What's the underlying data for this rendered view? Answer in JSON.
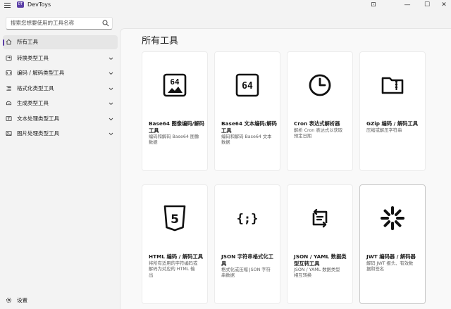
{
  "app": {
    "title": "DevToys",
    "logo_text": "DT"
  },
  "window": {
    "snap_glyph": "⊡",
    "minimize_glyph": "—",
    "maximize_glyph": "☐",
    "close_glyph": "✕"
  },
  "search": {
    "placeholder": "搜索您想要使用的工具名称"
  },
  "sidebar": {
    "items": [
      {
        "label": "所有工具",
        "icon": "home-icon",
        "selected": true
      },
      {
        "label": "转换类型工具",
        "icon": "convert-icon"
      },
      {
        "label": "编码 / 解码类型工具",
        "icon": "encode-icon"
      },
      {
        "label": "格式化类型工具",
        "icon": "format-icon"
      },
      {
        "label": "生成类型工具",
        "icon": "generate-icon"
      },
      {
        "label": "文本处理类型工具",
        "icon": "text-icon"
      },
      {
        "label": "图片处理类型工具",
        "icon": "image-icon"
      }
    ],
    "settings_label": "设置"
  },
  "main": {
    "title": "所有工具",
    "cards": [
      {
        "icon": "base64-image-icon",
        "glyph": "64",
        "title": [
          "Base64 图像编码/解码",
          "工具"
        ],
        "desc": [
          "编码和解码 Base64 图像",
          "数据"
        ]
      },
      {
        "icon": "base64-text-icon",
        "glyph": "64",
        "title": [
          "Base64 文本编码/解码",
          "工具"
        ],
        "desc": [
          "编码和解码 Base64 文本",
          "数据"
        ]
      },
      {
        "icon": "clock-icon",
        "title": [
          "Cron 表达式解析器"
        ],
        "desc": [
          "解析 Cron 表达式以获取",
          "预定日期"
        ]
      },
      {
        "icon": "gzip-icon",
        "title": [
          "GZip 编码 / 解码工具"
        ],
        "desc": [
          "压缩或解压字符串"
        ]
      },
      {
        "icon": "html5-icon",
        "glyph": "5",
        "title": [
          "HTML 编码 / 解码工具"
        ],
        "desc": [
          "将所有适用的字符编码或",
          "解码为对应的 HTML 输",
          "出"
        ]
      },
      {
        "icon": "json-icon",
        "glyph": "{;}",
        "title": [
          "JSON 字符串格式化工",
          "具"
        ],
        "desc": [
          "格式化或压缩 JSON 字符",
          "串数据"
        ]
      },
      {
        "icon": "swap-icon",
        "title": [
          "JSON / YAML 数据类",
          "型互转工具"
        ],
        "desc": [
          "JSON / YAML 数据类型",
          "相互转换"
        ]
      },
      {
        "icon": "jwt-icon",
        "title": [
          "JWT 编码器 / 解码器"
        ],
        "desc": [
          "解码 JWT 报头、有效数",
          "据和签名"
        ]
      }
    ]
  }
}
